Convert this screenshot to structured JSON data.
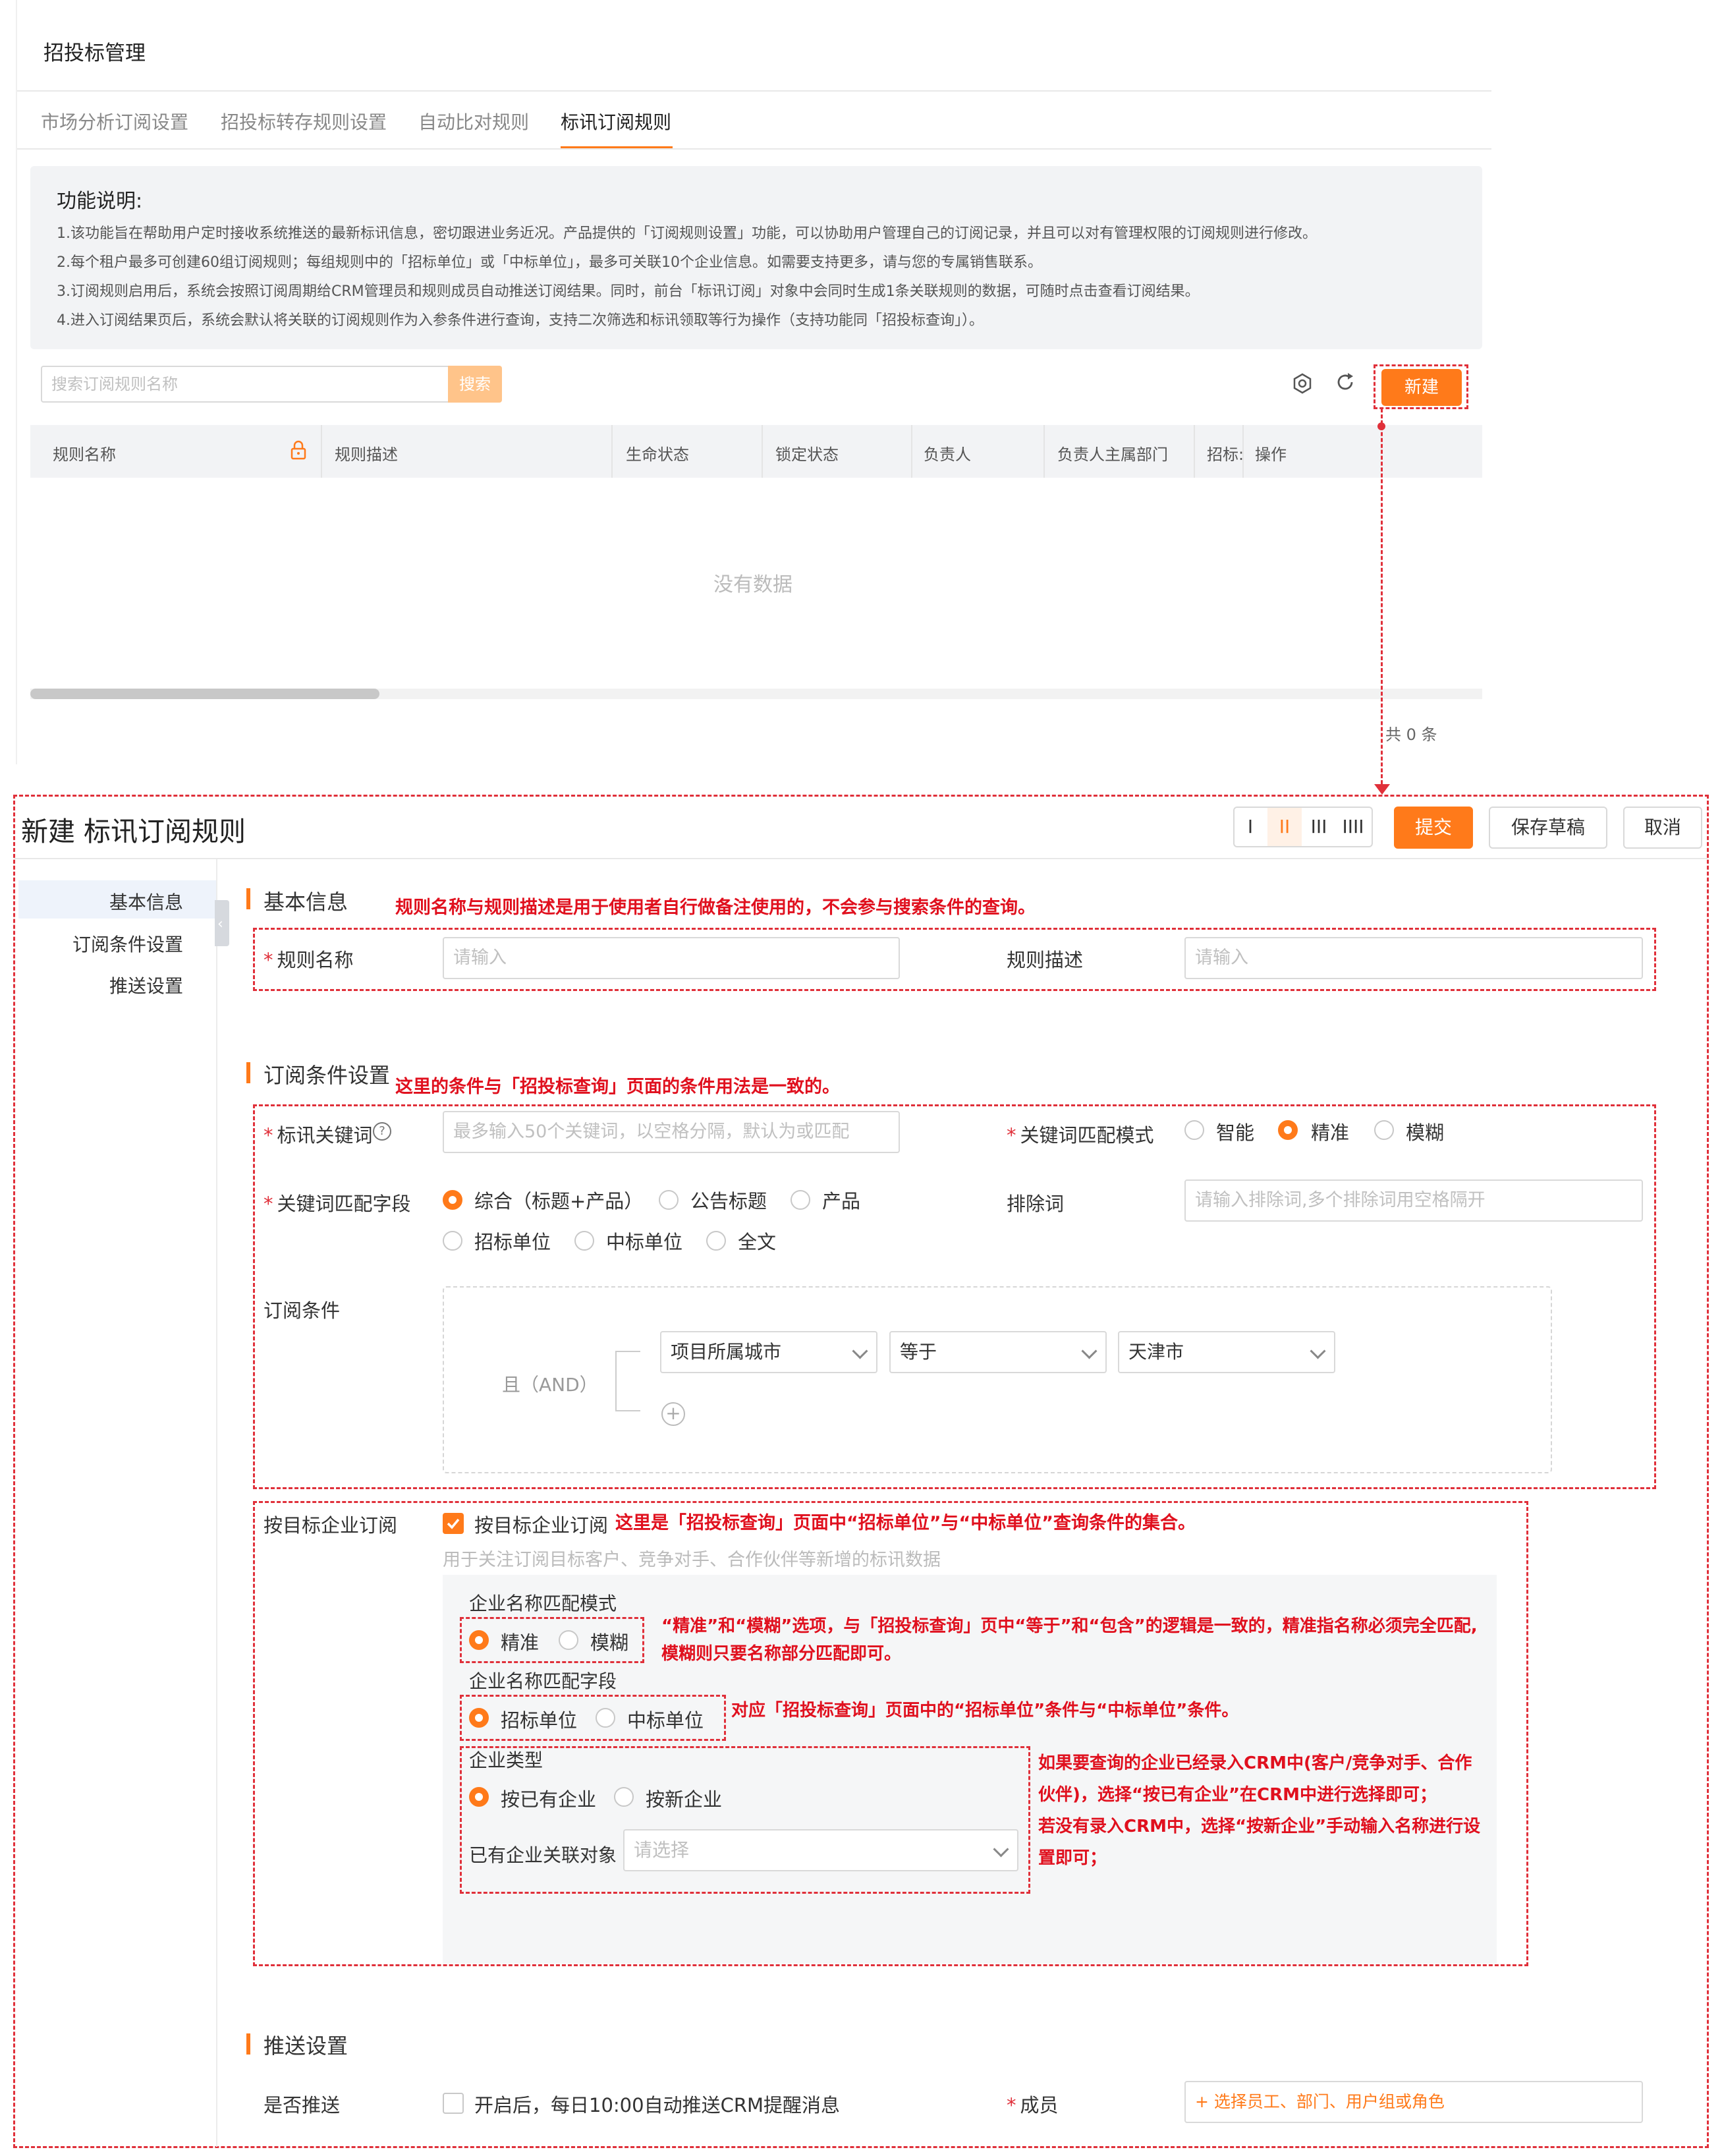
{
  "page_title": "招投标管理",
  "tabs": [
    {
      "label": "市场分析订阅设置"
    },
    {
      "label": "招投标转存规则设置"
    },
    {
      "label": "自动比对规则"
    },
    {
      "label": "标讯订阅规则"
    }
  ],
  "active_tab_index": 3,
  "notice": {
    "title": "功能说明:",
    "lines": [
      "1.该功能旨在帮助用户定时接收系统推送的最新标讯信息，密切跟进业务近况。产品提供的「订阅规则设置」功能，可以协助用户管理自己的订阅记录，并且可以对有管理权限的订阅规则进行修改。",
      "2.每个租户最多可创建60组订阅规则；每组规则中的「招标单位」或「中标单位」，最多可关联10个企业信息。如需要支持更多，请与您的专属销售联系。",
      "3.订阅规则启用后，系统会按照订阅周期给CRM管理员和规则成员自动推送订阅结果。同时，前台「标讯订阅」对象中会同时生成1条关联规则的数据，可随时点击查看订阅结果。",
      "4.进入订阅结果页后，系统会默认将关联的订阅规则作为入参条件进行查询，支持二次筛选和标讯领取等行为操作（支持功能同「招投标查询」）。"
    ]
  },
  "list": {
    "search_placeholder": "搜索订阅规则名称",
    "search_button": "搜索",
    "new_button": "新建",
    "columns": [
      "规则名称",
      "规则描述",
      "生命状态",
      "锁定状态",
      "负责人",
      "负责人主属部门",
      "招标:",
      "操作"
    ],
    "empty_text": "没有数据",
    "total_text": "共 0 条"
  },
  "form": {
    "title": "新建 标讯订阅规则",
    "layout_buttons": [
      "I",
      "II",
      "III",
      "IIII"
    ],
    "submit": "提交",
    "save_draft": "保存草稿",
    "cancel": "取消",
    "side_nav": [
      "基本信息",
      "订阅条件设置",
      "推送设置"
    ],
    "basic": {
      "section_title": "基本信息",
      "note": "规则名称与规则描述是用于使用者自行做备注使用的，不会参与搜索条件的查询。",
      "name_label": "规则名称",
      "name_placeholder": "请输入",
      "desc_label": "规则描述",
      "desc_placeholder": "请输入"
    },
    "conditions": {
      "section_title": "订阅条件设置",
      "note": "这里的条件与「招投标查询」页面的条件用法是一致的。",
      "keyword_label": "标讯关键词",
      "keyword_placeholder": "最多输入50个关键词，以空格分隔，默认为或匹配",
      "match_mode_label": "关键词匹配模式",
      "match_modes": [
        "智能",
        "精准",
        "模糊"
      ],
      "match_mode_selected": 1,
      "match_field_label": "关键词匹配字段",
      "match_fields_row1": [
        "综合（标题+产品）",
        "公告标题",
        "产品"
      ],
      "match_fields_row2": [
        "招标单位",
        "中标单位",
        "全文"
      ],
      "exclude_label": "排除词",
      "exclude_placeholder": "请输入排除词,多个排除词用空格隔开",
      "sub_cond_label": "订阅条件",
      "and_label": "且（AND）",
      "cond_field": "项目所属城市",
      "cond_operator": "等于",
      "cond_value": "天津市"
    },
    "target": {
      "label": "按目标企业订阅",
      "checkbox_label": "按目标企业订阅",
      "checked": true,
      "note": "这里是「招投标查询」页面中“招标单位”与“中标单位”查询条件的集合。",
      "hint": "用于关注订阅目标客户、竞争对手、合作伙伴等新增的标讯数据",
      "name_match_label": "企业名称匹配模式",
      "name_match_options": [
        "精准",
        "模糊"
      ],
      "name_match_note_1": "“精准”和“模糊”选项，与「招投标查询」页中“等于”和“包含”的逻辑是一致的，精准指名称必须完全匹配,",
      "name_match_note_2": "模糊则只要名称部分匹配即可。",
      "name_field_label": "企业名称匹配字段",
      "name_field_options": [
        "招标单位",
        "中标单位"
      ],
      "name_field_note": "对应「招投标查询」页面中的“招标单位”条件与“中标单位”条件。",
      "type_label": "企业类型",
      "type_options": [
        "按已有企业",
        "按新企业"
      ],
      "type_note_lines": [
        "如果要查询的企业已经录入CRM中(客户/竞争对手、合作",
        "伙伴)，选择“按已有企业”在CRM中进行选择即可；",
        "若没有录入CRM中，选择“按新企业”手动输入名称进行设",
        "置即可；"
      ],
      "related_label": "已有企业关联对象",
      "related_placeholder": "请选择"
    },
    "push": {
      "section_title": "推送设置",
      "push_label": "是否推送",
      "push_checkbox": "开启后，每日10:00自动推送CRM提醒消息",
      "members_label": "成员",
      "members_placeholder": "+ 选择员工、部门、用户组或角色"
    }
  },
  "colors": {
    "accent": "#ff7a1a",
    "annotation": "#e0101e",
    "notice_bg": "#f2f3f5"
  }
}
